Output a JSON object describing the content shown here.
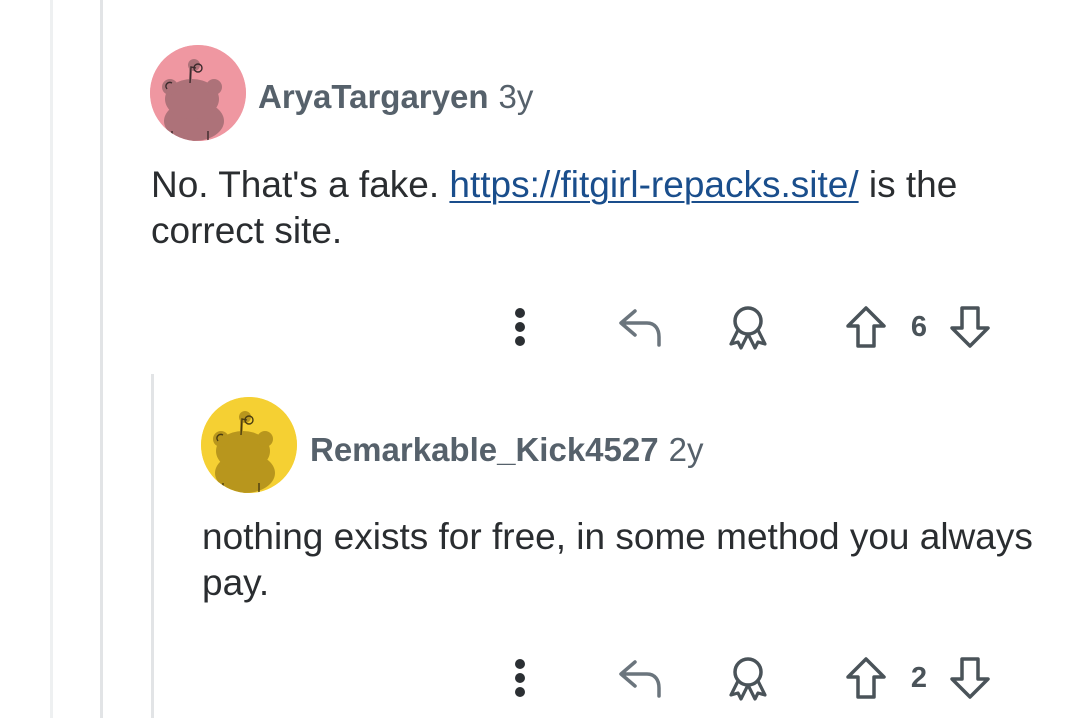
{
  "comments": [
    {
      "author": "AryaTargaryen",
      "age": "3y",
      "body_text": "No. That's a fake. ",
      "link_text": "https://fitgirl-repacks.site/",
      "body_after": " is the correct site.",
      "vote_count": "6",
      "avatar_color": "#ef97a1",
      "avatar_figure_color": "#ad7279"
    },
    {
      "author": "Remarkable_Kick4527",
      "age": "2y",
      "body_text": "nothing exists for free, in some method you always pay.",
      "vote_count": "2",
      "avatar_color": "#f5d033",
      "avatar_figure_color": "#b8961d"
    }
  ],
  "icons": {
    "more": "more-vertical-icon",
    "reply": "reply-arrow-icon",
    "award": "award-icon",
    "upvote": "upvote-arrow-icon",
    "downvote": "downvote-arrow-icon"
  },
  "colors": {
    "thread_line": "#e2e4e6",
    "meta_text": "#56616b",
    "link": "#1a4e8c",
    "icon": "#5b6670"
  }
}
